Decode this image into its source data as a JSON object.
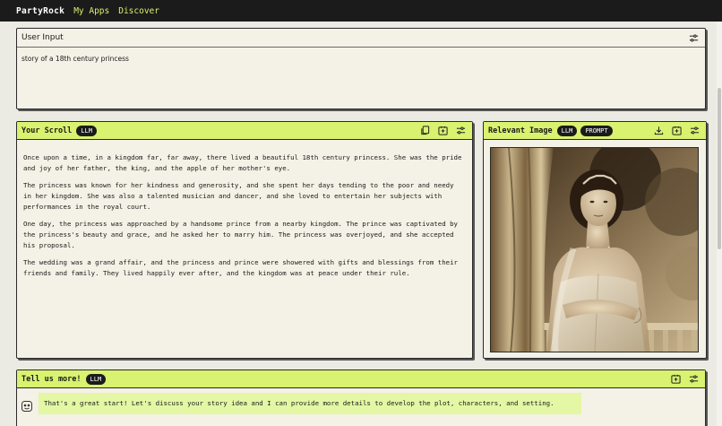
{
  "nav": {
    "brand": "PartyRock",
    "links": [
      "My Apps",
      "Discover"
    ]
  },
  "user_input": {
    "title": "User Input",
    "value": "story of a 18th century princess",
    "settings_icon": "sliders-icon"
  },
  "scroll": {
    "title": "Your Scroll",
    "badge": "LLM",
    "icons": [
      "copy-icon",
      "add-to-app-icon",
      "sliders-icon"
    ],
    "paragraphs": [
      "Once upon a time, in a kingdom far, far away, there lived a beautiful 18th century princess. She was the pride and joy of her father, the king, and the apple of her mother's eye.",
      "The princess was known for her kindness and generosity, and she spent her days tending to the poor and needy in her kingdom. She was also a talented musician and dancer, and she loved to entertain her subjects with performances in the royal court.",
      "One day, the princess was approached by a handsome prince from a nearby kingdom. The prince was captivated by the princess's beauty and grace, and he asked her to marry him. The princess was overjoyed, and she accepted his proposal.",
      "The wedding was a grand affair, and the princess and prince were showered with gifts and blessings from their friends and family. They lived happily ever after, and the kingdom was at peace under their rule."
    ]
  },
  "image_panel": {
    "title": "Relevant Image",
    "badges": [
      "LLM",
      "PROMPT"
    ],
    "icons": [
      "download-icon",
      "add-to-app-icon",
      "sliders-icon"
    ]
  },
  "chat": {
    "title": "Tell us more!",
    "badge": "LLM",
    "icons": [
      "add-to-app-icon",
      "sliders-icon"
    ],
    "message": "That's a great start! Let's discuss your story idea and I can provide more details to develop the plot, characters, and setting."
  },
  "colors": {
    "accent_green": "#d9f26f",
    "chat_bubble": "#e4f7a4",
    "nav_bg": "#1b1b1b",
    "panel_bg": "#f4f1e6"
  }
}
